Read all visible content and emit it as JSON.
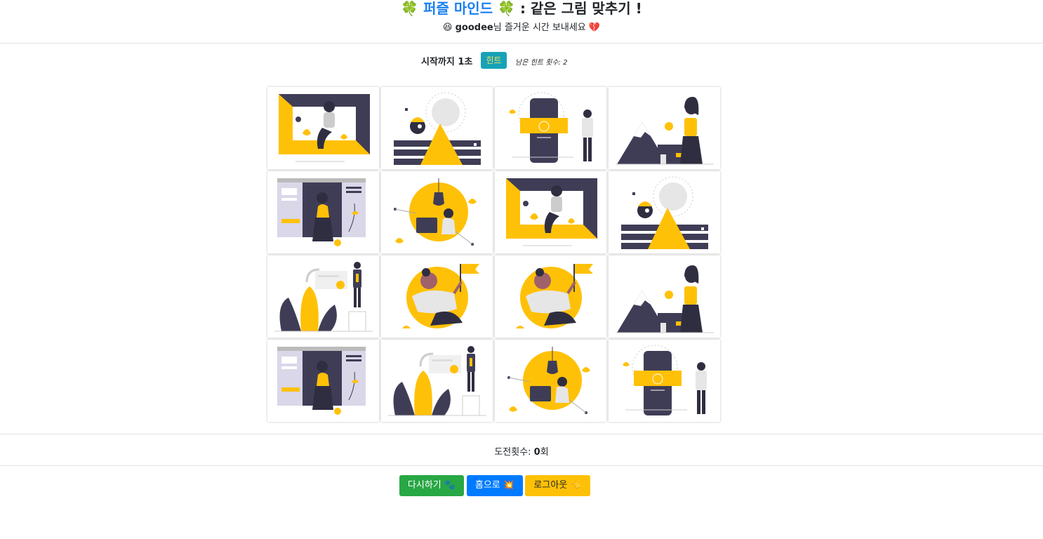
{
  "header": {
    "clover": "🍀",
    "brand": "퍼즐 마인드",
    "title_suffix": " : 같은 그림 맞추기 !",
    "face_emoji": "😆",
    "username": "goodee",
    "greeting": "님 즐거운 시간 보내세요",
    "heart_emoji": "💔"
  },
  "controls": {
    "countdown": "시작까지 1초",
    "hint_label": "힌트",
    "hints_left": "남은 힌트 횟수: 2"
  },
  "colors": {
    "accent": "#ffc107",
    "dark": "#3f3d56",
    "brand": "#1a7ff0"
  },
  "cards": [
    {
      "picture": "woman-sitting-frame"
    },
    {
      "picture": "blob-creature-pyramid"
    },
    {
      "picture": "phone-man-standing"
    },
    {
      "picture": "woman-mountains-house"
    },
    {
      "picture": "browser-woman-plant"
    },
    {
      "picture": "woman-reading-lightbulb"
    },
    {
      "picture": "woman-sitting-frame"
    },
    {
      "picture": "blob-creature-pyramid"
    },
    {
      "picture": "man-giant-flower"
    },
    {
      "picture": "woman-yellow-flag"
    },
    {
      "picture": "woman-yellow-flag"
    },
    {
      "picture": "woman-mountains-house"
    },
    {
      "picture": "browser-woman-plant"
    },
    {
      "picture": "man-giant-flower"
    },
    {
      "picture": "woman-reading-lightbulb"
    },
    {
      "picture": "phone-man-standing"
    }
  ],
  "stats": {
    "tries_label": "도전횟수: ",
    "tries_value": "0",
    "tries_unit": "회"
  },
  "buttons": {
    "retry": "다시하기 🐾",
    "home": "홈으로 💥",
    "logout": "로그아웃 👈"
  }
}
